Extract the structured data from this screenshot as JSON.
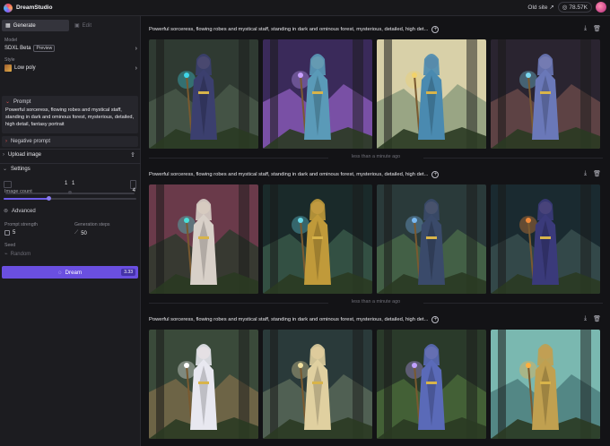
{
  "app": {
    "name": "DreamStudio"
  },
  "topbar": {
    "old_site": "Old site",
    "credits": "78.57K"
  },
  "sidebar": {
    "tabs": {
      "generate": "Generate",
      "edit": "Edit",
      "ghost": ""
    },
    "model": {
      "label": "Model",
      "value": "SDXL Beta",
      "badge": "Preview"
    },
    "style": {
      "label": "Style",
      "value": "Low poly"
    },
    "prompt": {
      "label": "Prompt",
      "text": "Powerful sorceress, flowing robes and mystical staff, standing in dark and ominous forest, mysterious, detailed, high detail, fantasy portrait"
    },
    "negative_prompt": {
      "label": "Negative prompt"
    },
    "upload_image": {
      "label": "Upload image"
    },
    "settings": {
      "label": "Settings",
      "ratio": {
        "w": "1",
        "h": "1"
      },
      "image_count": {
        "label": "Image count",
        "value": "4",
        "fraction": 0.34
      },
      "advanced": {
        "label": "Advanced"
      },
      "prompt_strength": {
        "label": "Prompt strength",
        "value": "5"
      },
      "generation_steps": {
        "label": "Generation steps",
        "value": "50"
      },
      "seed": {
        "label": "Seed",
        "value": "Random"
      }
    },
    "dream_button": {
      "label": "Dream",
      "cost": "3.33"
    }
  },
  "batches": [
    {
      "prompt": "Powerful sorceress, flowing robes and mystical staff, standing in dark and ominous forest, mysterious, detailed, high det...",
      "images": [
        {
          "robe": "#3b3f6e",
          "bg1": "#2f3a32",
          "bg2": "#4a5a4a",
          "glow": "#3fd6e8"
        },
        {
          "robe": "#5a9ab8",
          "bg1": "#3a2a5a",
          "bg2": "#8a5ab8",
          "glow": "#c9a0ff"
        },
        {
          "robe": "#4a8ab0",
          "bg1": "#d8d0a8",
          "bg2": "#8a9a7a",
          "glow": "#f2d26a"
        },
        {
          "robe": "#6a78b8",
          "bg1": "#2a2430",
          "bg2": "#6a4a4a",
          "glow": "#7ad8f0"
        }
      ],
      "time": "less than a minute ago"
    },
    {
      "prompt": "Powerful sorceress, flowing robes and mystical staff, standing in dark and ominous forest, mysterious, detailed, high det...",
      "images": [
        {
          "robe": "#d8d0c8",
          "bg1": "#6a3a4a",
          "bg2": "#2a3a2a",
          "glow": "#4ae0d8"
        },
        {
          "robe": "#c09a3a",
          "bg1": "#1a2a2a",
          "bg2": "#3a5a4a",
          "glow": "#6ad8e8"
        },
        {
          "robe": "#3a4a6a",
          "bg1": "#2a3a3a",
          "bg2": "#4a6a4a",
          "glow": "#7ab8f0"
        },
        {
          "robe": "#3a3a7a",
          "bg1": "#1a2a30",
          "bg2": "#3a5050",
          "glow": "#f08a3a"
        }
      ],
      "time": "less than a minute ago"
    },
    {
      "prompt": "Powerful sorceress, flowing robes and mystical staff, standing in dark and ominous forest, mysterious, detailed, high det...",
      "images": [
        {
          "robe": "#e8e8f0",
          "bg1": "#3a4a3a",
          "bg2": "#7a6a4a",
          "glow": "#ffffff"
        },
        {
          "robe": "#e0d0a0",
          "bg1": "#2a3a3a",
          "bg2": "#5a6a5a",
          "glow": "#f0e0a0"
        },
        {
          "robe": "#5a6ab8",
          "bg1": "#2a3a2a",
          "bg2": "#4a6a3a",
          "glow": "#c0a0ff"
        },
        {
          "robe": "#c0a050",
          "bg1": "#7ab8b0",
          "bg2": "#4a7a7a",
          "glow": "#ffb040"
        }
      ],
      "time": ""
    }
  ],
  "colors": {
    "accent": "#6a4fe0",
    "sidebar_bg": "#1c1c20",
    "page_bg": "#131316"
  }
}
